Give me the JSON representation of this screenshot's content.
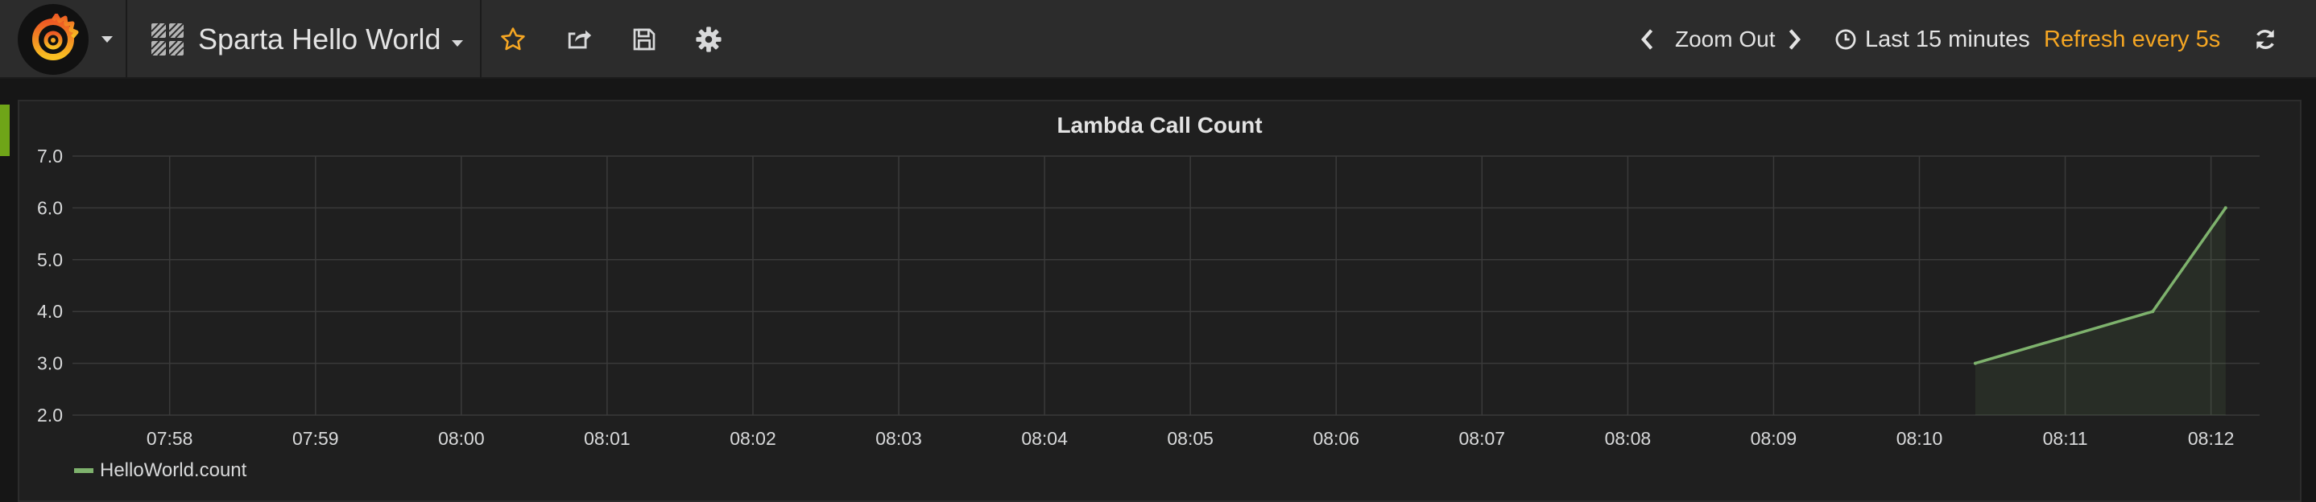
{
  "navbar": {
    "dashboard_title": "Sparta Hello World",
    "zoom_out_label": "Zoom Out",
    "time_range_label": "Last 15 minutes",
    "refresh_label": "Refresh every 5s"
  },
  "icons": {
    "logo": "grafana-logo-icon",
    "dashboard": "dashboard-grid-icon",
    "star": "star-icon",
    "share": "share-icon",
    "save": "save-icon",
    "settings": "gear-icon",
    "prev": "chevron-left-icon",
    "next": "chevron-right-icon",
    "clock": "clock-icon",
    "refresh": "refresh-icon"
  },
  "colors": {
    "accent": "#f5a623",
    "series": "#7eb26d",
    "row_marker": "#6fa518"
  },
  "panel": {
    "legend": [
      {
        "name": "HelloWorld.count",
        "color": "#7eb26d"
      }
    ]
  },
  "chart_data": {
    "type": "line",
    "title": "Lambda Call Count",
    "xlabel": "",
    "ylabel": "",
    "x_ticks": [
      "07:58",
      "07:59",
      "08:00",
      "08:01",
      "08:02",
      "08:03",
      "08:04",
      "08:05",
      "08:06",
      "08:07",
      "08:08",
      "08:09",
      "08:10",
      "08:11",
      "08:12"
    ],
    "y_ticks": [
      "2.0",
      "3.0",
      "4.0",
      "5.0",
      "6.0",
      "7.0"
    ],
    "xlim": [
      "07:57:20",
      "08:12:20"
    ],
    "ylim": [
      2,
      7
    ],
    "grid": true,
    "legend_position": "bottom-left",
    "series": [
      {
        "name": "HelloWorld.count",
        "x": [
          "08:10:23",
          "08:11:36",
          "08:12:06"
        ],
        "y": [
          3,
          4,
          6
        ]
      }
    ]
  }
}
